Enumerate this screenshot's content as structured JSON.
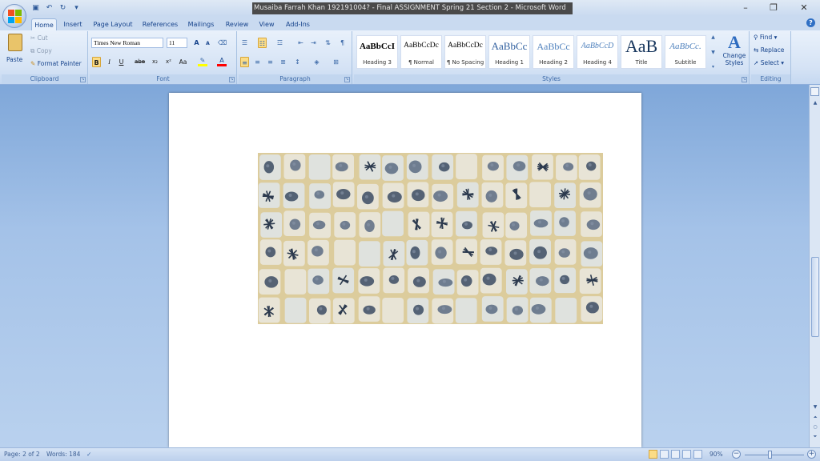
{
  "window": {
    "title": "Musaiba Farrah Khan 192191004? - Final ASSIGNMENT Spring 21 Section 2 - Microsoft Word",
    "minimize_icon": "minimize-icon",
    "restore_icon": "restore-icon",
    "close_icon": "close-icon"
  },
  "tabs": [
    "Home",
    "Insert",
    "Page Layout",
    "References",
    "Mailings",
    "Review",
    "View",
    "Add-Ins"
  ],
  "active_tab": "Home",
  "clipboard": {
    "paste": "Paste",
    "cut": "Cut",
    "copy": "Copy",
    "format_painter": "Format Painter",
    "label": "Clipboard"
  },
  "font": {
    "name": "Times New Roman",
    "size": "11",
    "label": "Font",
    "grow": "A",
    "shrink": "A",
    "bold": "B",
    "italic": "I",
    "underline": "U",
    "strike": "abe",
    "sub": "x₂",
    "sup": "x²",
    "case": "Aa",
    "color": "A"
  },
  "paragraph": {
    "label": "Paragraph"
  },
  "styles": {
    "label": "Styles",
    "items": [
      {
        "preview": "AaBbCcI",
        "name": "Heading 3"
      },
      {
        "preview": "AaBbCcDc",
        "name": "¶ Normal"
      },
      {
        "preview": "AaBbCcDc",
        "name": "¶ No Spacing"
      },
      {
        "preview": "AaBbCc",
        "name": "Heading 1"
      },
      {
        "preview": "AaBbCc",
        "name": "Heading 2"
      },
      {
        "preview": "AaBbCcD",
        "name": "Heading 4"
      },
      {
        "preview": "AaB",
        "name": "Title"
      },
      {
        "preview": "AaBbCc.",
        "name": "Subtitle"
      }
    ],
    "change_styles_1": "Change",
    "change_styles_2": "Styles"
  },
  "editing": {
    "find": "Find",
    "replace": "Replace",
    "select": "Select",
    "label": "Editing"
  },
  "status": {
    "page": "Page: 2 of 2",
    "words": "Words: 184",
    "zoom": "90%"
  },
  "colors": {
    "highlight": "#ffff00",
    "font_color": "#ff0000",
    "ribbon_blue": "#15428b"
  }
}
